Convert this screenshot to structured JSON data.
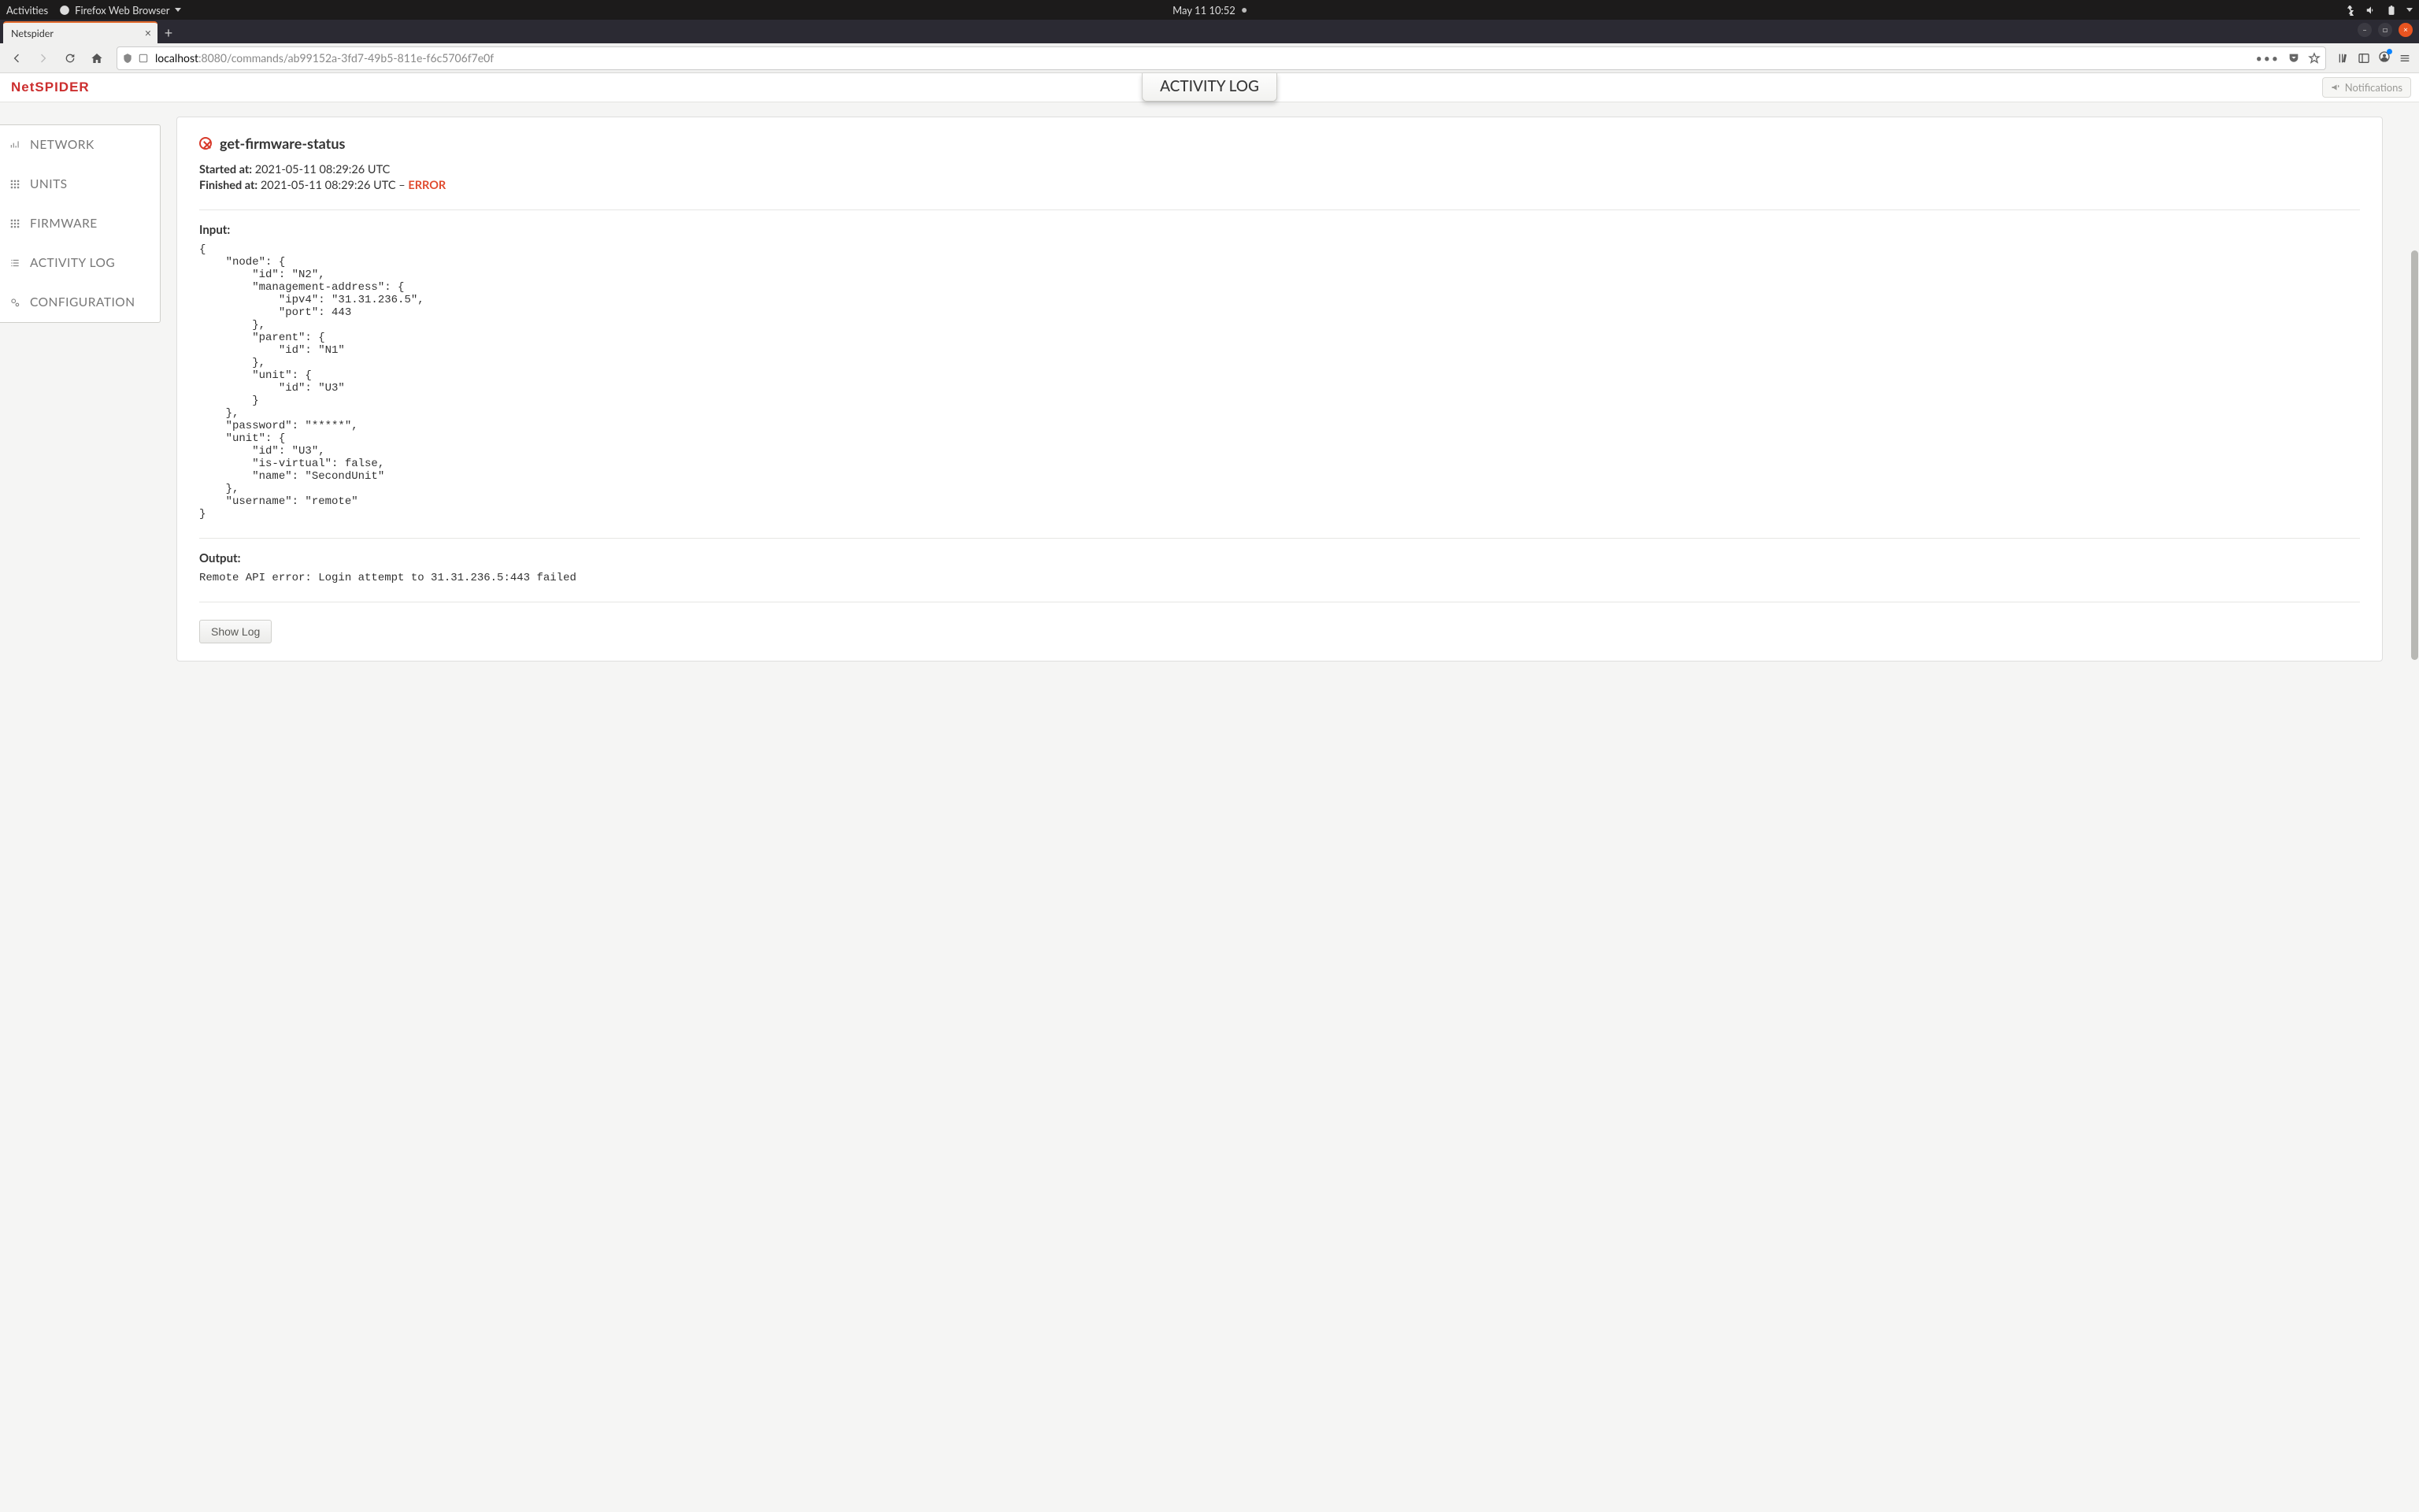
{
  "os_bar": {
    "activities": "Activities",
    "app_menu": "Firefox Web Browser",
    "clock": "May 11  10:52"
  },
  "browser": {
    "tab_title": "Netspider",
    "url_host": "localhost",
    "url_path": ":8080/commands/ab99152a-3fd7-49b5-811e-f6c5706f7e0f"
  },
  "app": {
    "logo": "NetSPIDER",
    "header_tab": "ACTIVITY LOG",
    "notifications_label": "Notifications"
  },
  "sidebar": {
    "items": [
      {
        "label": "NETWORK"
      },
      {
        "label": "UNITS"
      },
      {
        "label": "FIRMWARE"
      },
      {
        "label": "ACTIVITY LOG"
      },
      {
        "label": "CONFIGURATION"
      }
    ]
  },
  "command": {
    "name": "get-firmware-status",
    "started_label": "Started at:",
    "started_value": "2021-05-11 08:29:26 UTC",
    "finished_label": "Finished at:",
    "finished_value": "2021-05-11 08:29:26 UTC",
    "finished_sep": " – ",
    "status": "ERROR",
    "input_label": "Input:",
    "input_body": "{\n    \"node\": {\n        \"id\": \"N2\",\n        \"management-address\": {\n            \"ipv4\": \"31.31.236.5\",\n            \"port\": 443\n        },\n        \"parent\": {\n            \"id\": \"N1\"\n        },\n        \"unit\": {\n            \"id\": \"U3\"\n        }\n    },\n    \"password\": \"*****\",\n    \"unit\": {\n        \"id\": \"U3\",\n        \"is-virtual\": false,\n        \"name\": \"SecondUnit\"\n    },\n    \"username\": \"remote\"\n}",
    "output_label": "Output:",
    "output_body": "Remote API error: Login attempt to 31.31.236.5:443 failed",
    "show_log_label": "Show Log"
  }
}
